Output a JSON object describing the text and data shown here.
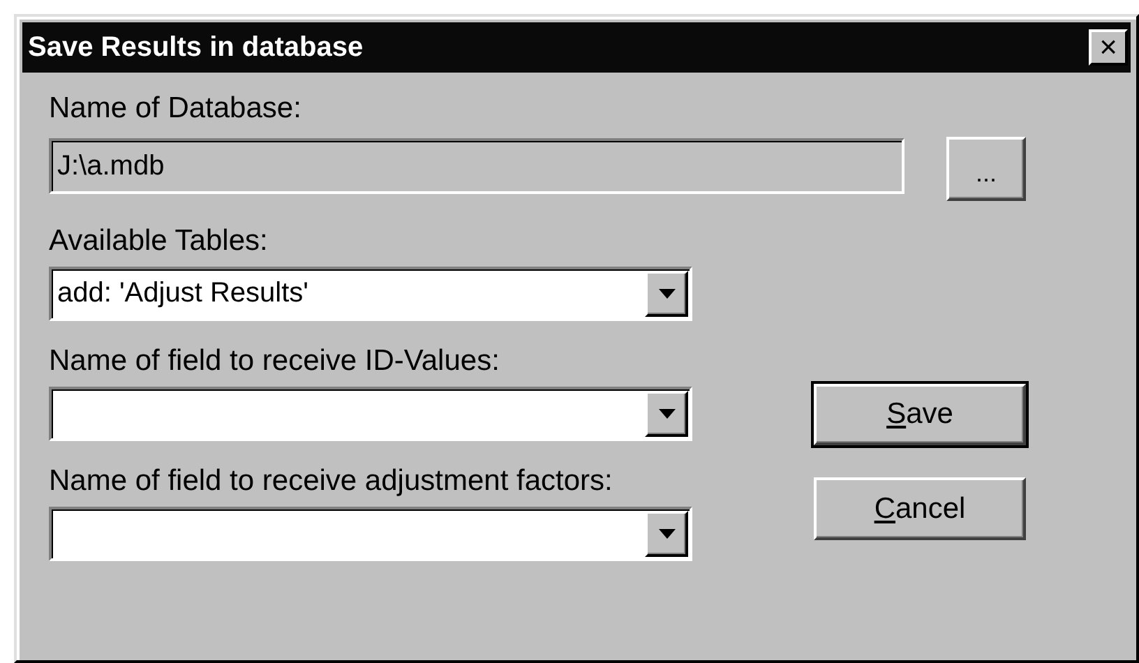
{
  "window": {
    "title": "Save Results in database",
    "close_button": "×"
  },
  "database": {
    "label": "Name of Database:",
    "value": "J:\\a.mdb",
    "disabled": true,
    "browse_button": "..."
  },
  "combos": [
    {
      "label": "Available Tables:",
      "value": "add: 'Adjust Results'"
    },
    {
      "label": "Name of field to receive ID-Values:"
    },
    {
      "label": "Name of field to receive adjustment factors:"
    }
  ],
  "buttons": [
    {
      "label": "Save",
      "underline_first_letter": true,
      "default": true
    },
    {
      "label": "Cancel",
      "underline_first_letter": true,
      "default": false
    }
  ]
}
